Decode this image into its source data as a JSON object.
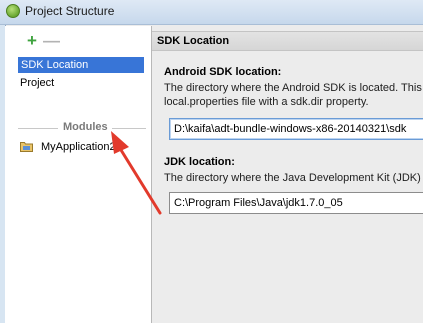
{
  "window": {
    "title": "Project Structure"
  },
  "sidebar": {
    "add_symbol": "+",
    "remove_symbol": "—",
    "items": [
      {
        "label": "SDK Location"
      },
      {
        "label": "Project"
      }
    ],
    "modules_header": "Modules",
    "modules": [
      {
        "label": "MyApplication2"
      }
    ]
  },
  "content": {
    "section_title": "SDK Location",
    "android_sdk": {
      "title": "Android SDK location:",
      "desc_line1": "The directory where the Android SDK is located. This",
      "desc_line2": "local.properties file with a sdk.dir property.",
      "value": "D:\\kaifa\\adt-bundle-windows-x86-20140321\\sdk"
    },
    "jdk": {
      "title": "JDK location:",
      "desc_line1": "The directory where the Java Development Kit (JDK) i",
      "value": "C:\\Program Files\\Java\\jdk1.7.0_05"
    }
  },
  "colors": {
    "selection": "#3875d7",
    "arrow": "#e23a2c",
    "add_button": "#3fa33f"
  }
}
